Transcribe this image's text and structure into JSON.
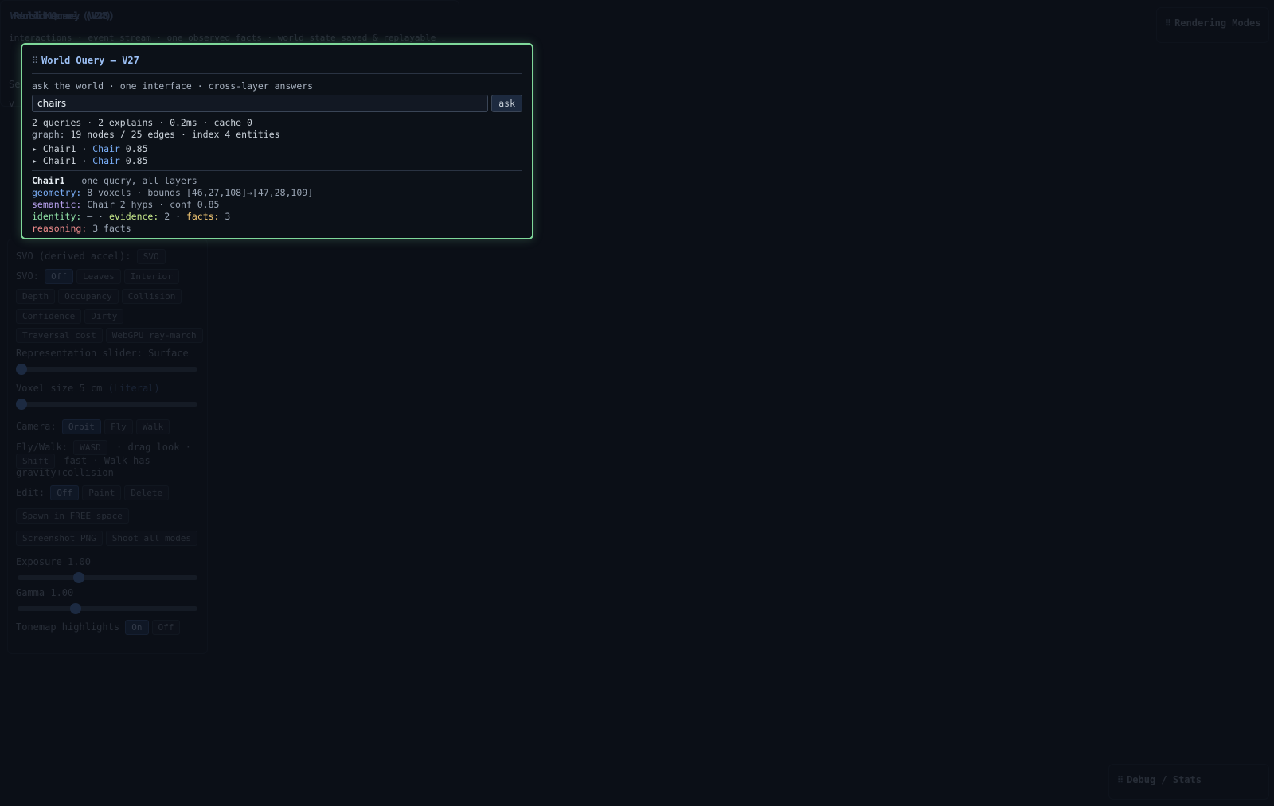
{
  "background": {
    "stack_titles": [
      "World Kernel (V23)",
      "Persistence (V24)",
      "World Query (V25)"
    ],
    "stack_subtitle": "interactions · event stream · one observed facts · world state saved & replayable",
    "left_labels": [
      "Se",
      "v"
    ],
    "rendering_modes": "Rendering Modes",
    "debug_stats": "Debug / Stats"
  },
  "left_panel": {
    "svo_label": "SVO (derived accel):",
    "svo_button": "SVO",
    "svo_mode_label": "SVO:",
    "svo_modes": [
      "Off",
      "Leaves",
      "Interior",
      "Depth",
      "Occupancy",
      "Collision",
      "Confidence",
      "Dirty",
      "Traversal cost",
      "WebGPU ray-march"
    ],
    "rep_slider_label": "Representation slider: Surface",
    "voxel_size_label": "Voxel size 5 cm",
    "voxel_size_mode": "(Literal)",
    "camera_label": "Camera:",
    "camera_modes": [
      "Orbit",
      "Fly",
      "Walk"
    ],
    "flywalk_line1_a": "Fly/Walk:",
    "flywalk_key1": "WASD",
    "flywalk_line1_b": "· drag look ·",
    "flywalk_key2": "Shift",
    "flywalk_line2_b": "fast · Walk has",
    "flywalk_line3": "gravity+collision",
    "edit_label": "Edit:",
    "edit_modes": [
      "Off",
      "Paint",
      "Delete"
    ],
    "spawn_button": "Spawn in FREE space",
    "screenshot_button": "Screenshot PNG",
    "shoot_all_button": "Shoot all modes",
    "exposure_label": "Exposure 1.00",
    "exposure_value": 0.33,
    "gamma_label": "Gamma 1.00",
    "gamma_value": 0.31,
    "tonemap_label": "Tonemap highlights",
    "tonemap_options": [
      "On",
      "Off"
    ]
  },
  "world_query": {
    "title": "World Query — V27",
    "subtitle": "ask the world · one interface · cross-layer answers",
    "query_value": "chairs",
    "ask_label": "ask",
    "stats": "2 queries · 2 explains · 0.2ms · cache 0",
    "graph_key": "graph:",
    "graph_value": "19 nodes / 25 edges · index 4 entities",
    "results": [
      {
        "bullet": "▸",
        "name": "Chair1",
        "sep": "·",
        "type": "Chair",
        "score": "0.85"
      },
      {
        "bullet": "▸",
        "name": "Chair1",
        "sep": "·",
        "type": "Chair",
        "score": "0.85"
      }
    ],
    "detail": {
      "entity": "Chair1",
      "entity_note": "— one query, all layers",
      "geometry_key": "geometry:",
      "geometry_value": "8 voxels · bounds [46,27,108]→[47,28,109]",
      "semantic_key": "semantic:",
      "semantic_value": "Chair 2 hyps · conf 0.85",
      "identity_key": "identity:",
      "identity_value": "— ·",
      "evidence_key": "evidence:",
      "evidence_value": "2 ·",
      "facts_key": "facts:",
      "facts_value": "3",
      "reasoning_key": "reasoning:",
      "reasoning_value": "3 facts"
    }
  }
}
